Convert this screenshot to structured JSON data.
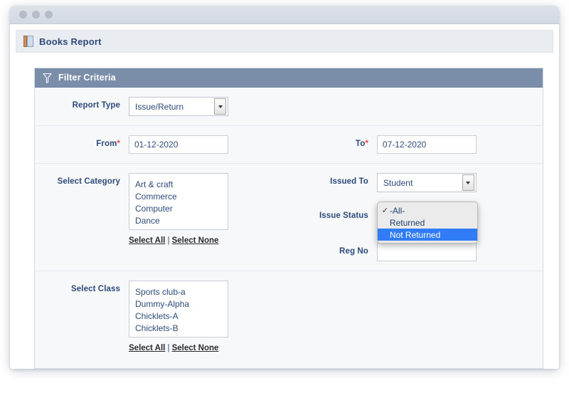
{
  "window": {
    "traffic_lights": [
      "close",
      "minimize",
      "zoom"
    ]
  },
  "page": {
    "title": "Books Report",
    "icon": "book-icon"
  },
  "panel": {
    "icon": "funnel-icon",
    "title": "Filter Criteria",
    "header_color": "#7a8da9"
  },
  "fields": {
    "report_type": {
      "label": "Report Type",
      "value": "Issue/Return",
      "options": [
        "Issue/Return"
      ]
    },
    "from": {
      "label": "From",
      "required_mark": "*",
      "value": "01-12-2020"
    },
    "to": {
      "label": "To",
      "required_mark": "*",
      "value": "07-12-2020"
    },
    "select_category": {
      "label": "Select Category",
      "options": [
        "Art & craft",
        "Commerce",
        "Computer",
        "Dance"
      ],
      "select_all": "Select All",
      "separator": "|",
      "select_none": "Select None"
    },
    "select_class": {
      "label": "Select Class",
      "options": [
        "Sports club-a",
        "Dummy-Alpha",
        "Chicklets-A",
        "Chicklets-B"
      ],
      "select_all": "Select All",
      "separator": "|",
      "select_none": "Select None"
    },
    "issued_to": {
      "label": "Issued To",
      "value": "Student",
      "options": [
        "Student"
      ]
    },
    "issue_status": {
      "label": "Issue Status",
      "expanded": true,
      "selected": "-All-",
      "highlighted": "Not Returned",
      "check_glyph": "✓",
      "highlight_color": "#2f7cf6",
      "options": [
        {
          "label": "-All-",
          "checked": true,
          "highlighted": false
        },
        {
          "label": "Returned",
          "checked": false,
          "highlighted": false
        },
        {
          "label": "Not Returned",
          "checked": false,
          "highlighted": true
        }
      ]
    },
    "reg_no": {
      "label": "Reg No",
      "value": "",
      "placeholder": ""
    }
  }
}
